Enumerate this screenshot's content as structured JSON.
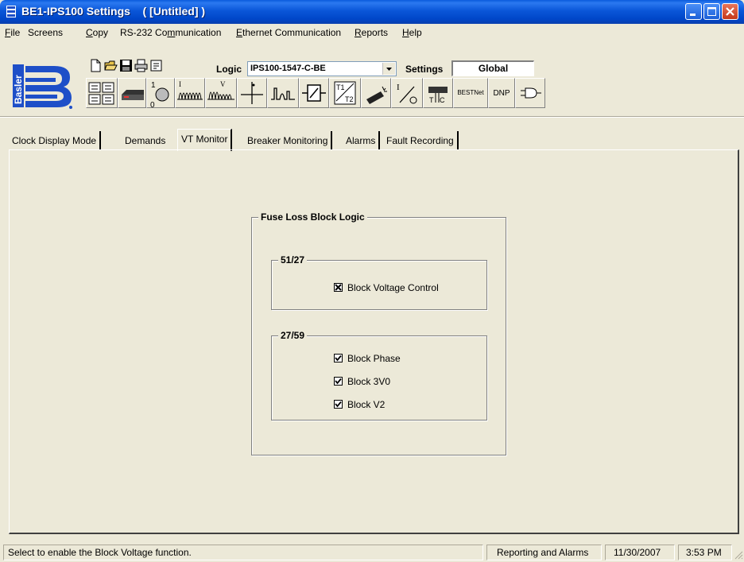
{
  "window": {
    "title": "BE1-IPS100 Settings    ( [Untitled] )"
  },
  "menu": [
    {
      "label": "File",
      "key": "F",
      "rest": "ile"
    },
    {
      "label": "Screens",
      "key": "",
      "rest": "Screens"
    },
    {
      "label": "Copy",
      "key": "C",
      "rest": "opy"
    },
    {
      "label": "RS-232 Communication",
      "key": "",
      "rest": "RS-232 Co"
    },
    {
      "label": "Ethernet Communication",
      "key": "E",
      "rest": "thernet Communication"
    },
    {
      "label": "Reports",
      "key": "R",
      "rest": "eports"
    },
    {
      "label": "Help",
      "key": "H",
      "rest": "elp"
    }
  ],
  "menu_rs232": {
    "pre": "RS-232 Co",
    "key": "m",
    "post": "munication"
  },
  "toolbar": {
    "logic_label": "Logic",
    "logic_value": "IPS100-1547-C-BE",
    "settings_label": "Settings",
    "settings_value": "Global",
    "logo_text": "Basler",
    "bestnet_label": "BESTNet",
    "dnp_label": "DNP"
  },
  "tabs": [
    {
      "label": "Clock Display Mode"
    },
    {
      "label": "Demands"
    },
    {
      "label": "VT Monitor",
      "active": true
    },
    {
      "label": "Breaker Monitoring"
    },
    {
      "label": "Alarms"
    },
    {
      "label": "Fault Recording"
    }
  ],
  "fuse_loss": {
    "title": "Fuse Loss Block Logic",
    "group_51_27": {
      "title": "51/27",
      "block_voltage_control": {
        "label": "Block Voltage Control",
        "checked": true
      }
    },
    "group_27_59": {
      "title": "27/59",
      "block_phase": {
        "label": "Block Phase",
        "checked": true
      },
      "block_3v0": {
        "label": "Block 3V0",
        "checked": true
      },
      "block_v2": {
        "label": "Block V2",
        "checked": true
      }
    }
  },
  "status": {
    "message": "Select to enable the Block Voltage function.",
    "mode": "Reporting and Alarms",
    "date": "11/30/2007",
    "time": "3:53 PM"
  },
  "colors": {
    "titlebar": "#0a56d8",
    "face": "#ece9d8",
    "logo_blue": "#1e4fc8"
  }
}
